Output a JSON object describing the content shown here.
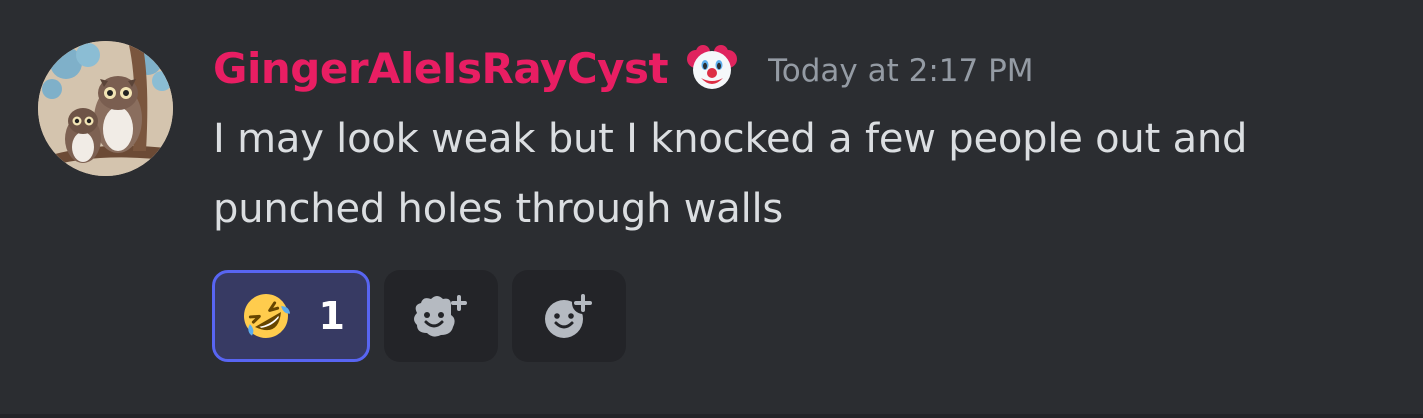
{
  "message": {
    "author": "GingerAleIsRayCyst",
    "role_icon": "clown-face-icon",
    "timestamp": "Today at 2:17 PM",
    "text": "I may look weak but I knocked a few people out and punched holes through walls"
  },
  "reactions": [
    {
      "emoji": "rolling-on-floor-laughing-icon",
      "count": "1",
      "selected": true
    }
  ],
  "actions": {
    "add_super_reaction_icon": "super-reaction-add-icon",
    "add_reaction_icon": "add-reaction-icon"
  },
  "colors": {
    "background": "#2b2d31",
    "username": "#e91e63",
    "text": "#dbdee1",
    "timestamp": "#949ba4",
    "reaction_selected_bg": "#373a63",
    "reaction_selected_border": "#5865f2",
    "reaction_button_bg": "#232428"
  }
}
